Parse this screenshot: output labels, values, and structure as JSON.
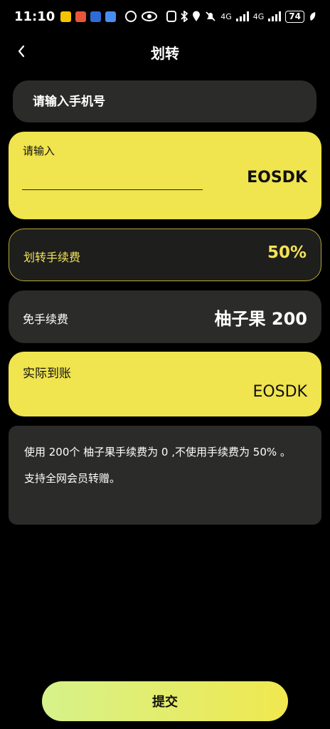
{
  "status": {
    "time": "11:10",
    "network": "4G",
    "battery": "74"
  },
  "header": {
    "title": "划转"
  },
  "phone": {
    "placeholder": "请输入手机号"
  },
  "amount": {
    "label": "请输入",
    "token": "EOSDK"
  },
  "fee": {
    "label": "划转手续费",
    "value": "50%"
  },
  "free_fee": {
    "label": "免手续费",
    "value": "柚子果 200"
  },
  "actual": {
    "label": "实际到账",
    "token": "EOSDK"
  },
  "note": {
    "line1": "使用 200个 柚子果手续费为 0 ,不使用手续费为 50% 。",
    "line2": "支持全网会员转赠。"
  },
  "submit": {
    "label": "提交"
  },
  "colors": {
    "accent_yellow": "#f0e44f",
    "dark_card": "#2b2b29",
    "background": "#000000"
  }
}
